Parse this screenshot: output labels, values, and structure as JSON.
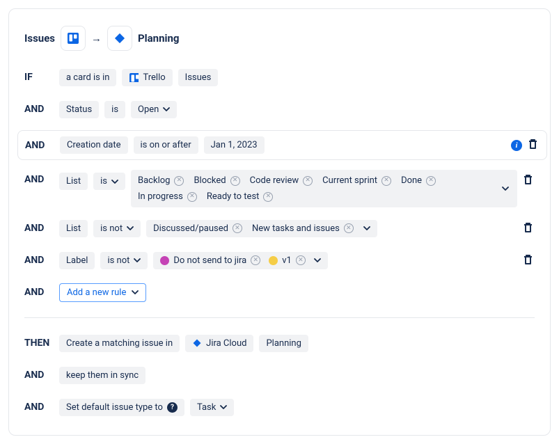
{
  "header": {
    "source_title": "Issues",
    "target_title": "Planning"
  },
  "icons": {
    "trello": "trello",
    "jira": "jira"
  },
  "keywords": {
    "if": "IF",
    "and": "AND",
    "then": "THEN"
  },
  "rules": {
    "card_in": {
      "prefix": "a card is in",
      "tool": "Trello",
      "container": "Issues"
    },
    "status": {
      "field": "Status",
      "op": "is",
      "value": "Open"
    },
    "creation": {
      "field": "Creation date",
      "op": "is on or after",
      "value": "Jan 1, 2023"
    },
    "list_is": {
      "field": "List",
      "op": "is",
      "values": [
        "Backlog",
        "Blocked",
        "Code review",
        "Current sprint",
        "Done",
        "In progress",
        "Ready to test"
      ]
    },
    "list_isnot": {
      "field": "List",
      "op": "is not",
      "values": [
        "Discussed/paused",
        "New tasks and issues"
      ]
    },
    "label_isnot": {
      "field": "Label",
      "op": "is not",
      "values": [
        {
          "color": "#C543B5",
          "text": "Do not send to jira"
        },
        {
          "color": "#F5CD47",
          "text": "v1"
        }
      ]
    },
    "add_rule": "Add a new rule"
  },
  "then": {
    "create": {
      "prefix": "Create a matching issue in",
      "tool": "Jira Cloud",
      "container": "Planning"
    },
    "sync": "keep them in sync",
    "default_type": {
      "prefix": "Set default issue type to",
      "value": "Task"
    }
  }
}
